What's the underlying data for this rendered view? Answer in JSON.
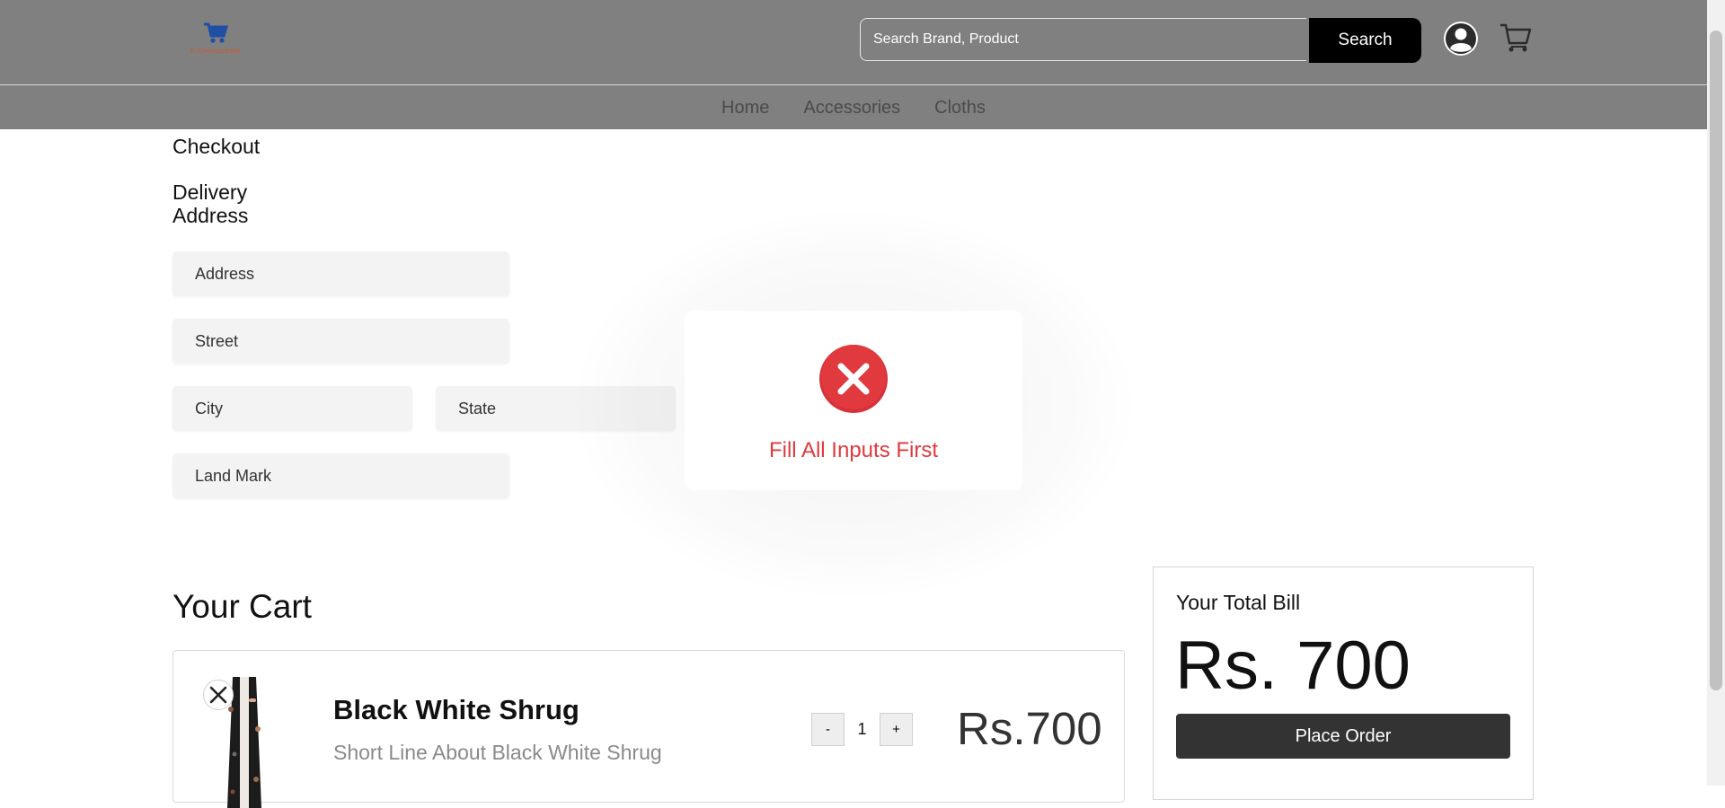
{
  "header": {
    "logo_text": "E-CommerceSite",
    "search": {
      "placeholder": "Search Brand, Product",
      "button_label": "Search"
    }
  },
  "nav": {
    "items": [
      "Home",
      "Accessories",
      "Cloths"
    ]
  },
  "checkout": {
    "title": "Checkout",
    "delivery_title": "Delivery Address",
    "fields": {
      "address": "Address",
      "street": "Street",
      "city": "City",
      "state": "State",
      "landmark": "Land Mark"
    }
  },
  "modal": {
    "message": "Fill All Inputs First",
    "icon": "error-x-icon",
    "color": "#e0393e"
  },
  "cart": {
    "title": "Your Cart",
    "items": [
      {
        "name": "Black White Shrug",
        "description": "Short Line About Black White Shrug",
        "quantity": "1",
        "minus_label": "-",
        "plus_label": "+",
        "price": "Rs.700"
      }
    ]
  },
  "bill": {
    "title": "Your Total Bill",
    "amount": "Rs. 700",
    "button_label": "Place Order"
  }
}
